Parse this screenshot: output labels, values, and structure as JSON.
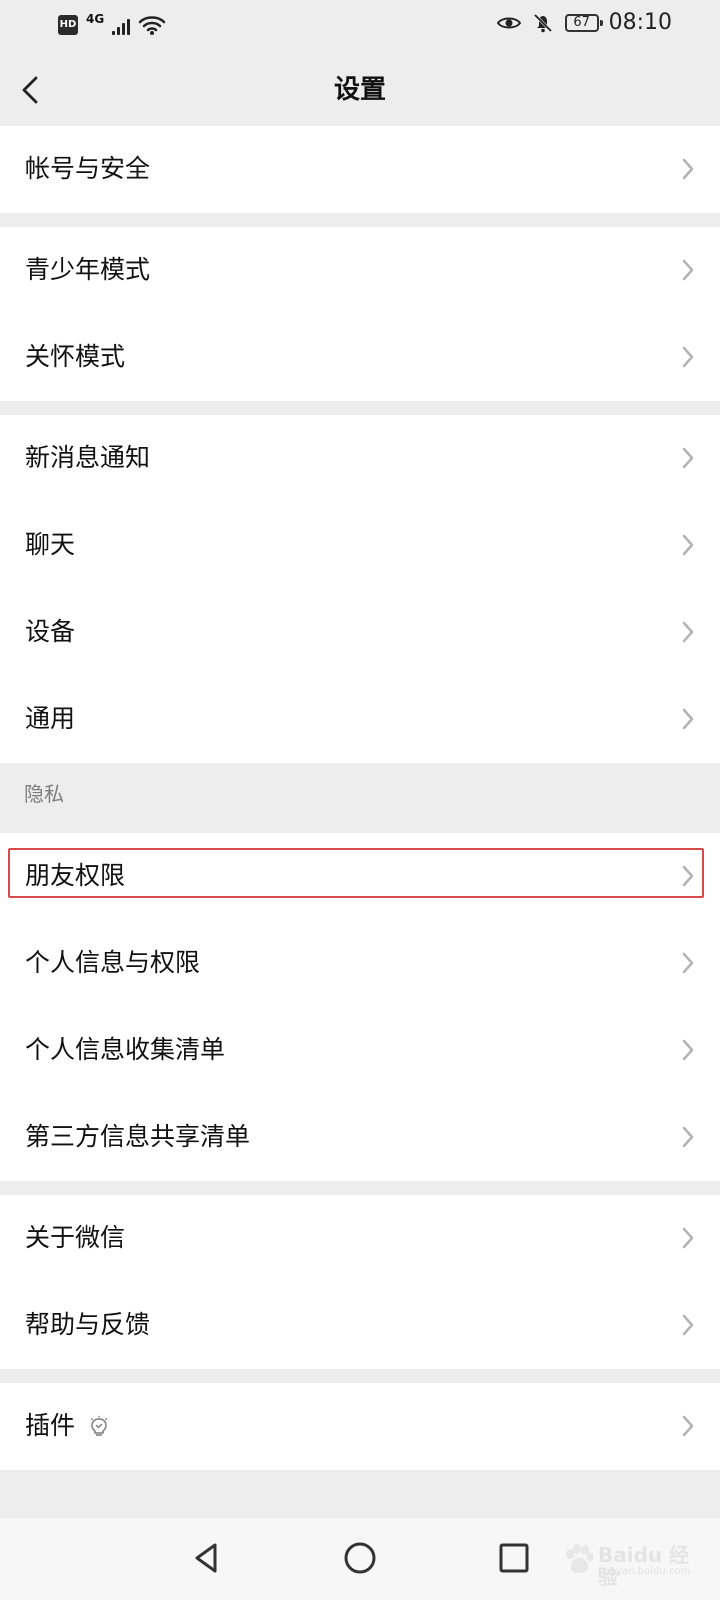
{
  "status_bar": {
    "hd_badge": "HD",
    "network": "4G",
    "battery_level": "67",
    "time": "08:10",
    "icons": [
      "hd-icon",
      "signal-icon",
      "wifi-icon",
      "eye-icon",
      "bell-off-icon",
      "battery-icon"
    ]
  },
  "nav": {
    "title": "设置",
    "back_icon": "back-arrow-icon"
  },
  "sections": {
    "account": {
      "items": [
        {
          "label": "帐号与安全"
        }
      ]
    },
    "modes": {
      "items": [
        {
          "label": "青少年模式"
        },
        {
          "label": "关怀模式"
        }
      ]
    },
    "general": {
      "items": [
        {
          "label": "新消息通知"
        },
        {
          "label": "聊天"
        },
        {
          "label": "设备"
        },
        {
          "label": "通用"
        }
      ]
    },
    "privacy": {
      "header": "隐私",
      "items": [
        {
          "label": "朋友权限",
          "highlighted": true
        },
        {
          "label": "个人信息与权限"
        },
        {
          "label": "个人信息收集清单"
        },
        {
          "label": "第三方信息共享清单"
        }
      ]
    },
    "about": {
      "items": [
        {
          "label": "关于微信"
        },
        {
          "label": "帮助与反馈"
        }
      ]
    },
    "plugins": {
      "items": [
        {
          "label": "插件",
          "icon": "lightbulb-icon"
        }
      ]
    }
  },
  "colors": {
    "background": "#ededed",
    "row_background": "#ffffff",
    "text": "#111111",
    "muted_text": "#7f7f7f",
    "highlight": "#d84a4a",
    "chevron": "#b3b3b3"
  },
  "system_nav": {
    "buttons": [
      "back-triangle-icon",
      "home-circle-icon",
      "recent-square-icon"
    ]
  },
  "watermark": {
    "main": "Baidu 经验",
    "sub": "jingyan.baidu.com"
  }
}
